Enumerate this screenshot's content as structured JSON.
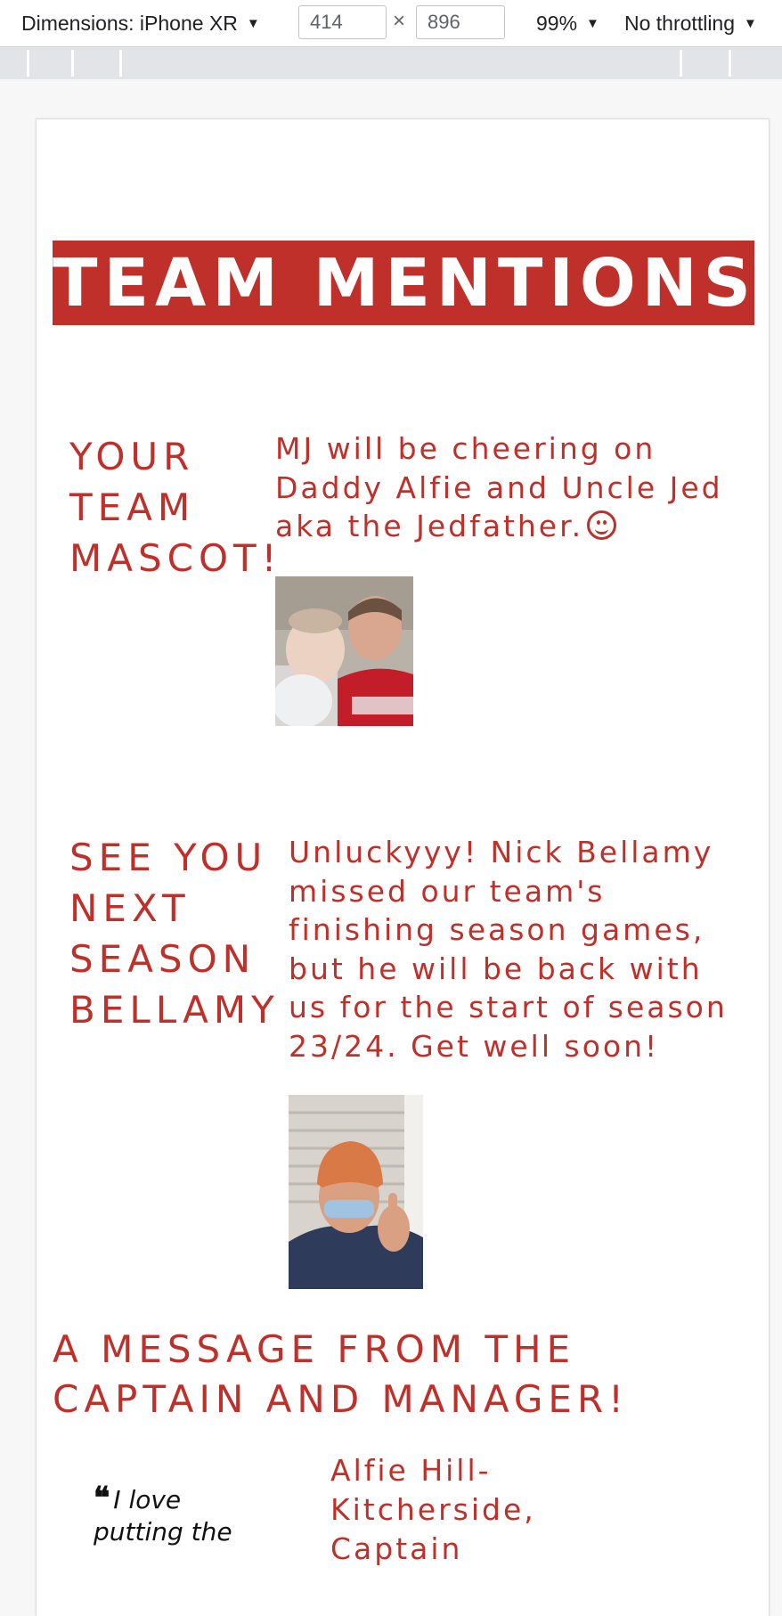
{
  "devtools": {
    "device_label": "Dimensions: iPhone XR",
    "width_value": "414",
    "times_symbol": "×",
    "height_value": "896",
    "zoom_label": "99%",
    "throttle_label": "No throttling",
    "dropdown_glyph": "▼"
  },
  "colors": {
    "brand_red": "#c0302a"
  },
  "page": {
    "banner_title": "TEAM MENTIONS",
    "mascot": {
      "heading_lines": [
        "YOUR",
        "TEAM",
        "MASCOT!"
      ],
      "text_lines": [
        "MJ will be cheering on",
        "Daddy Alfie and Uncle Jed",
        "aka the Jedfather."
      ],
      "emoji": "smiling-face-icon"
    },
    "bellamy": {
      "heading_lines": [
        "SEE YOU",
        "NEXT",
        "SEASON",
        "BELLAMY"
      ],
      "text_lines": [
        "Unluckyyy! Nick Bellamy",
        "missed our team's",
        "finishing season games,",
        "but he will be back with",
        "us for the start of season",
        "23/24. Get well soon!"
      ]
    },
    "captain_heading_lines": [
      "A MESSAGE FROM THE",
      "CAPTAIN AND MANAGER!"
    ],
    "quote_lines": [
      "I love",
      "putting the"
    ],
    "signature_lines": [
      "Alfie Hill-",
      "Kitcherside,",
      "Captain"
    ]
  }
}
